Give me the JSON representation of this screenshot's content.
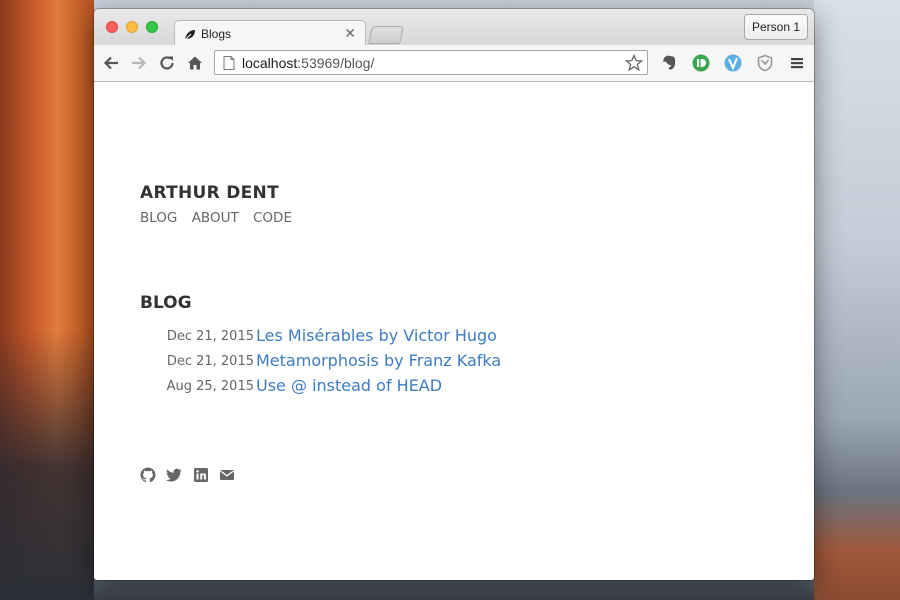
{
  "browser": {
    "tab": {
      "title": "Blogs"
    },
    "profile": "Person 1",
    "url": {
      "host": "localhost",
      "port_path": ":53969/blog/"
    }
  },
  "site": {
    "title": "ARTHUR DENT",
    "nav": [
      "BLOG",
      "ABOUT",
      "CODE"
    ]
  },
  "blog": {
    "heading": "BLOG",
    "posts": [
      {
        "date": "Dec 21, 2015",
        "title": "Les Misérables by Victor Hugo"
      },
      {
        "date": "Dec 21, 2015",
        "title": "Metamorphosis by Franz Kafka"
      },
      {
        "date": "Aug 25, 2015",
        "title": "Use @ instead of HEAD"
      }
    ]
  },
  "icons": {
    "social": [
      "github-icon",
      "twitter-icon",
      "linkedin-icon",
      "email-icon"
    ],
    "extensions": [
      "evernote-icon",
      "pushbullet-icon",
      "vimium-icon",
      "shield-extension-icon"
    ]
  },
  "colors": {
    "link": "#3d7cc0",
    "heading": "#333333",
    "muted": "#666666"
  }
}
